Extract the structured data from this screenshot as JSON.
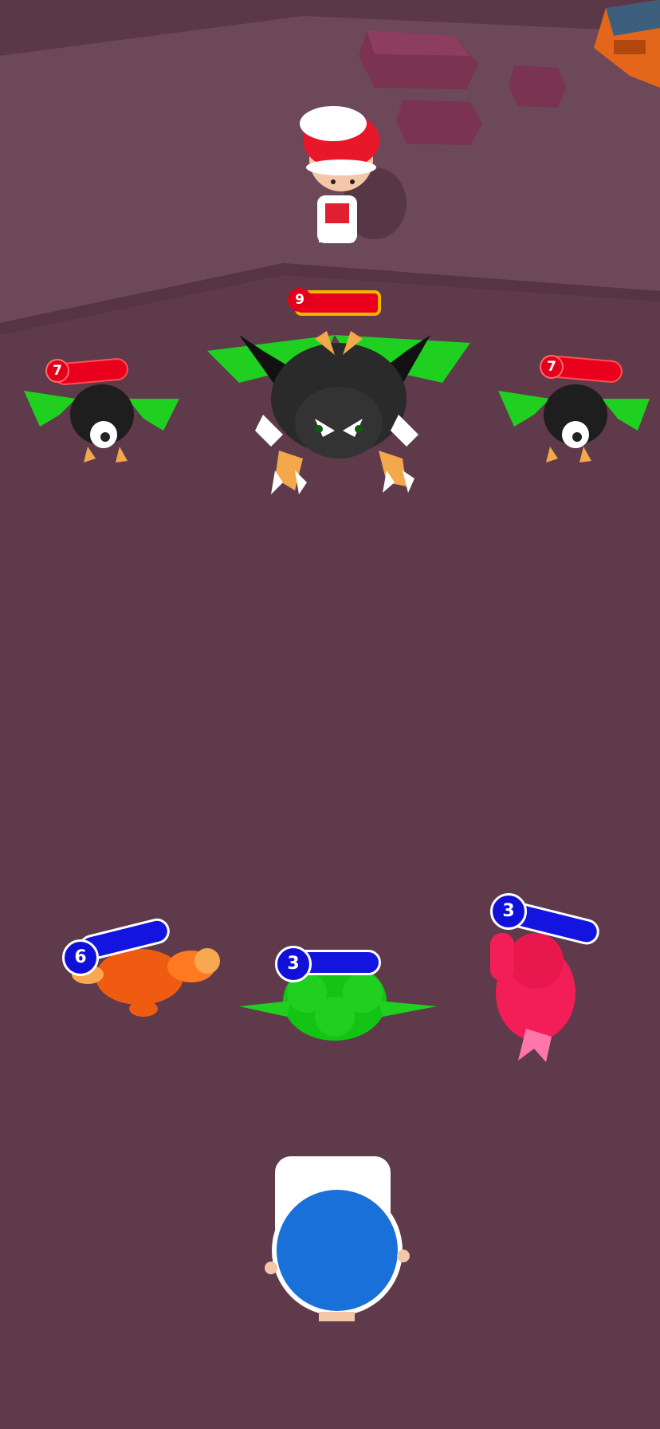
{
  "boss": {
    "name": "green-dragon",
    "hp": "9"
  },
  "enemies": [
    {
      "name": "bat-left",
      "hp": "7"
    },
    {
      "name": "bat-right",
      "hp": "7"
    }
  ],
  "allies": [
    {
      "name": "orange-creature",
      "hp": "6"
    },
    {
      "name": "green-turtle",
      "hp": "3"
    },
    {
      "name": "pink-creature",
      "hp": "3"
    }
  ],
  "trainers": {
    "opponent": "red-cap-trainer",
    "player": "blue-cap-trainer"
  },
  "colors": {
    "ground": "#5e3a4b",
    "plateau": "#6e4a5b",
    "enemy_hp": "#e8001c",
    "ally_hp": "#1414e0",
    "boss_frame": "#f5b400"
  }
}
